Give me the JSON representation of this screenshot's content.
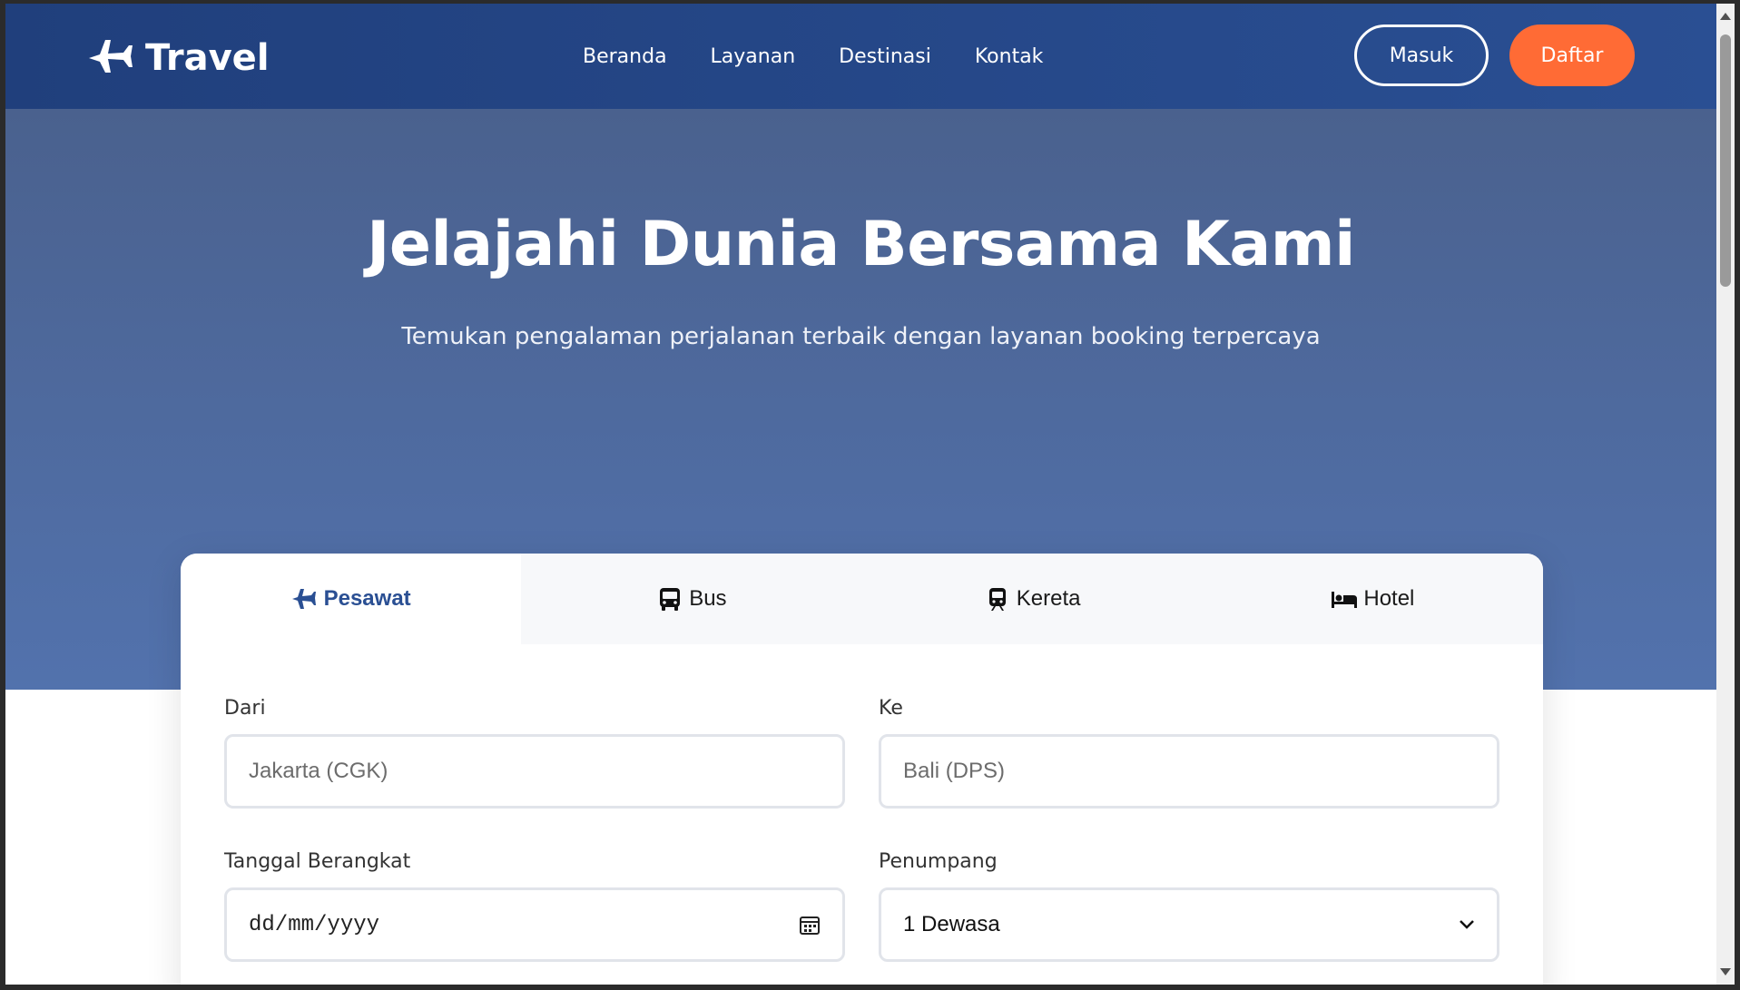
{
  "nav": {
    "brand": "Travel",
    "links": [
      "Beranda",
      "Layanan",
      "Destinasi",
      "Kontak"
    ],
    "login_label": "Masuk",
    "register_label": "Daftar"
  },
  "hero": {
    "title": "Jelajahi Dunia Bersama Kami",
    "subtitle": "Temukan pengalaman perjalanan terbaik dengan layanan booking terpercaya"
  },
  "booking": {
    "tabs": [
      "Pesawat",
      "Bus",
      "Kereta",
      "Hotel"
    ],
    "active_tab": "Pesawat",
    "from": {
      "label": "Dari",
      "placeholder": "Jakarta (CGK)"
    },
    "to": {
      "label": "Ke",
      "placeholder": "Bali (DPS)"
    },
    "date": {
      "label": "Tanggal Berangkat",
      "placeholder": "dd/mm/yyyy"
    },
    "passengers": {
      "label": "Penumpang",
      "value": "1 Dewasa"
    }
  },
  "colors": {
    "navbar": "#2a4f93",
    "hero": "#5272ad",
    "accent": "#ff6b35",
    "active_tab": "#2a4f93"
  }
}
